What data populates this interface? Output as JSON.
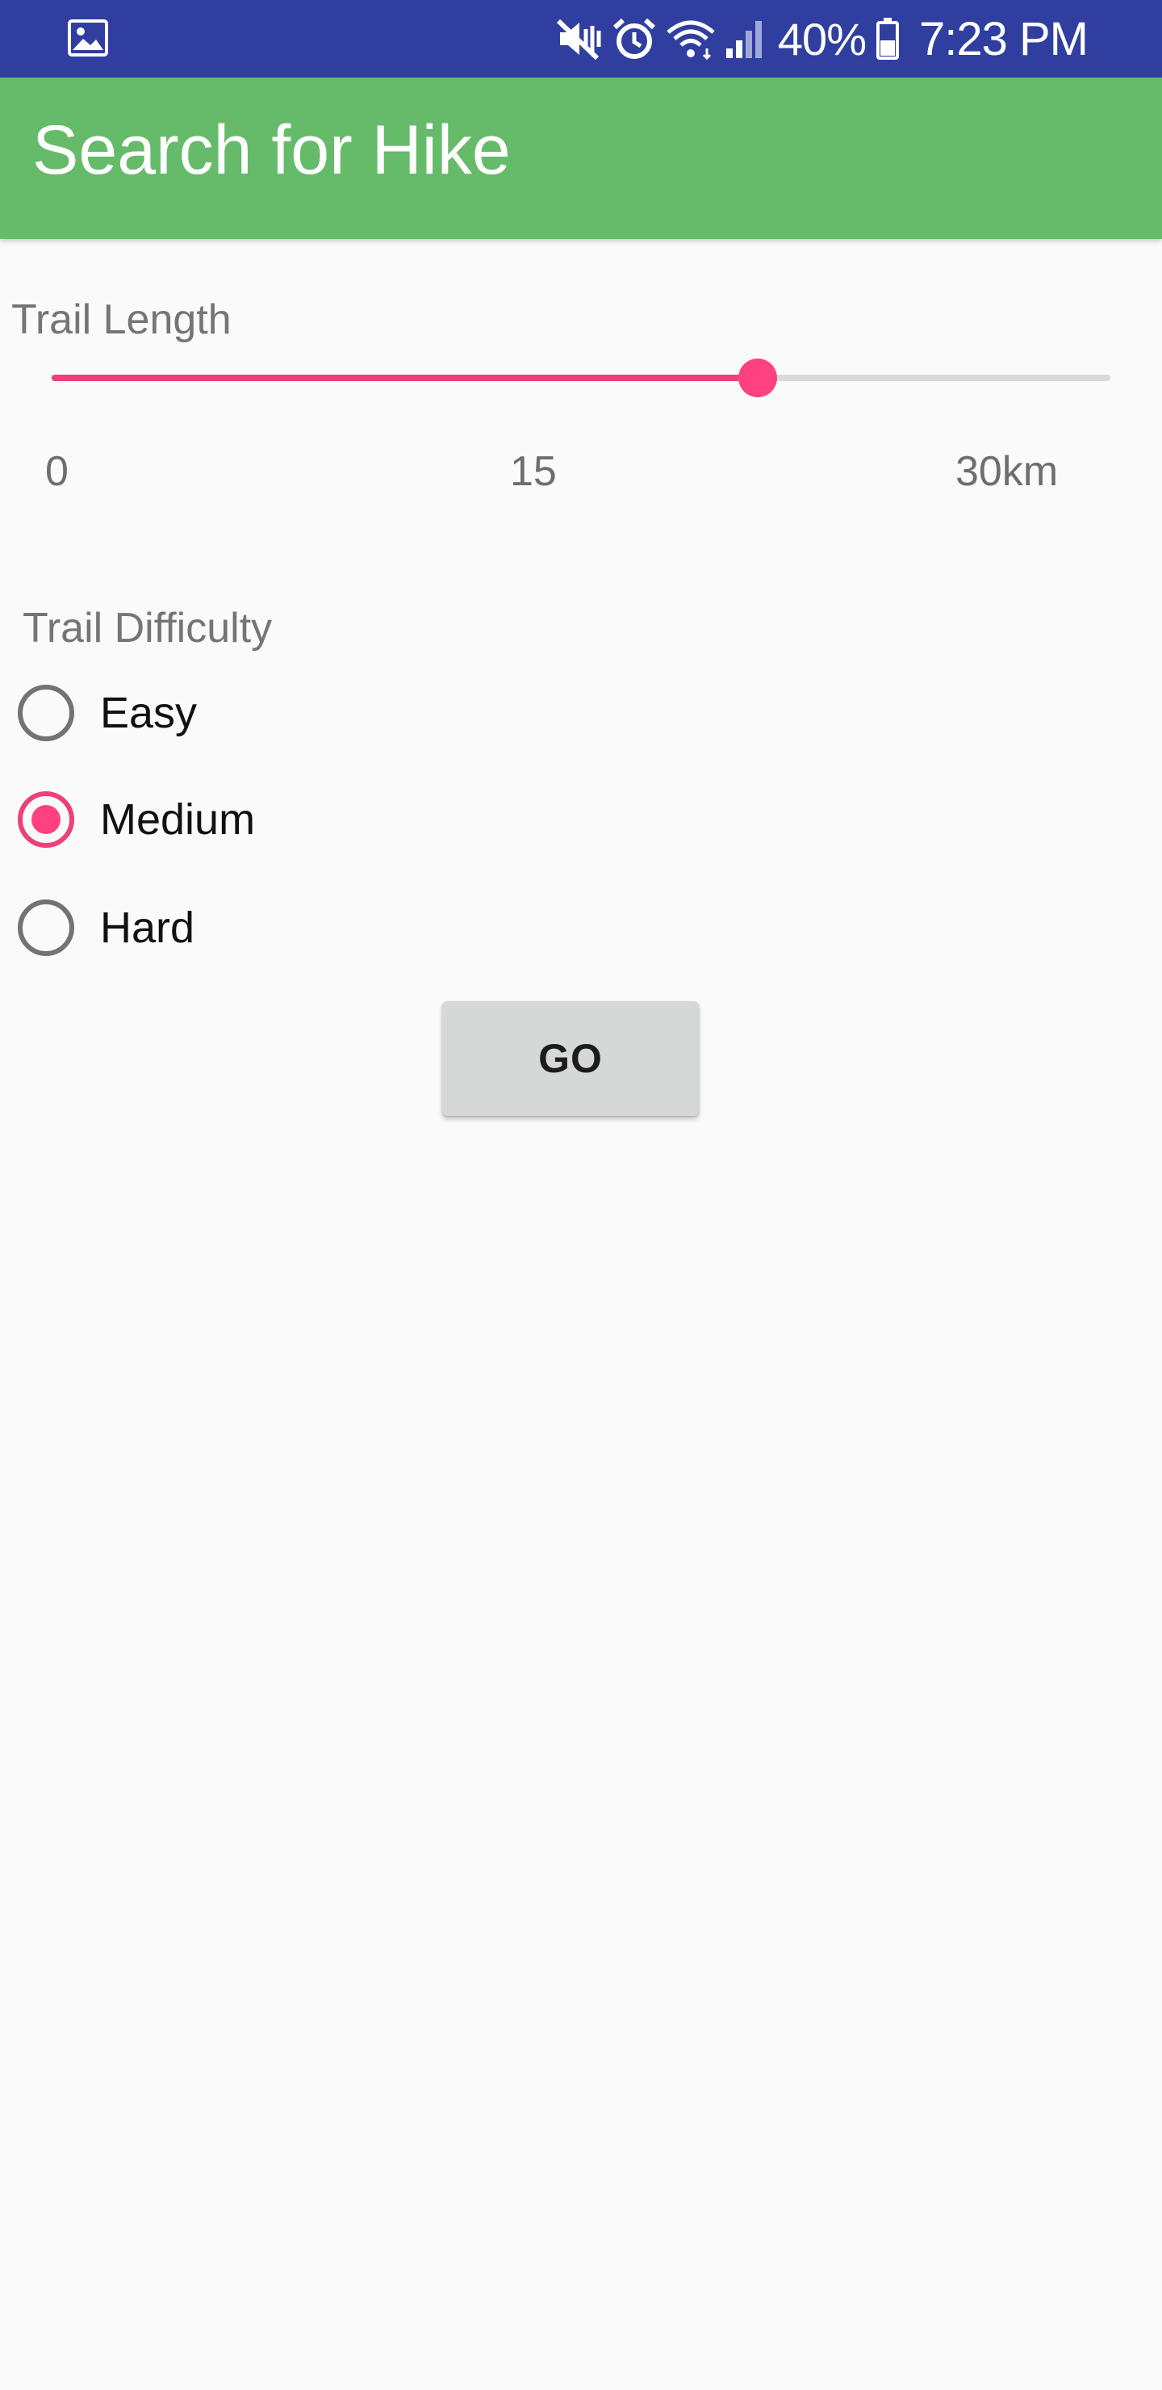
{
  "status_bar": {
    "notification_icon": "gallery-icon",
    "system_icons": [
      "mute-vibrate-icon",
      "alarm-icon",
      "wifi-icon",
      "cell-signal-icon"
    ],
    "battery_percent": "40%",
    "battery_icon": "battery-icon",
    "time": "7:23 PM",
    "background_color": "#303f9f"
  },
  "app_bar": {
    "title": "Search for Hike",
    "background_color": "#66bb6a"
  },
  "trail_length": {
    "label": "Trail Length",
    "slider": {
      "min": 0,
      "max": 30,
      "value": 20,
      "accent_color": "#ff4081"
    },
    "ticks": [
      "0",
      "15",
      "30km"
    ]
  },
  "trail_difficulty": {
    "label": "Trail Difficulty",
    "options": [
      {
        "label": "Easy",
        "selected": false
      },
      {
        "label": "Medium",
        "selected": true
      },
      {
        "label": "Hard",
        "selected": false
      }
    ]
  },
  "go_button": {
    "label": "GO"
  }
}
